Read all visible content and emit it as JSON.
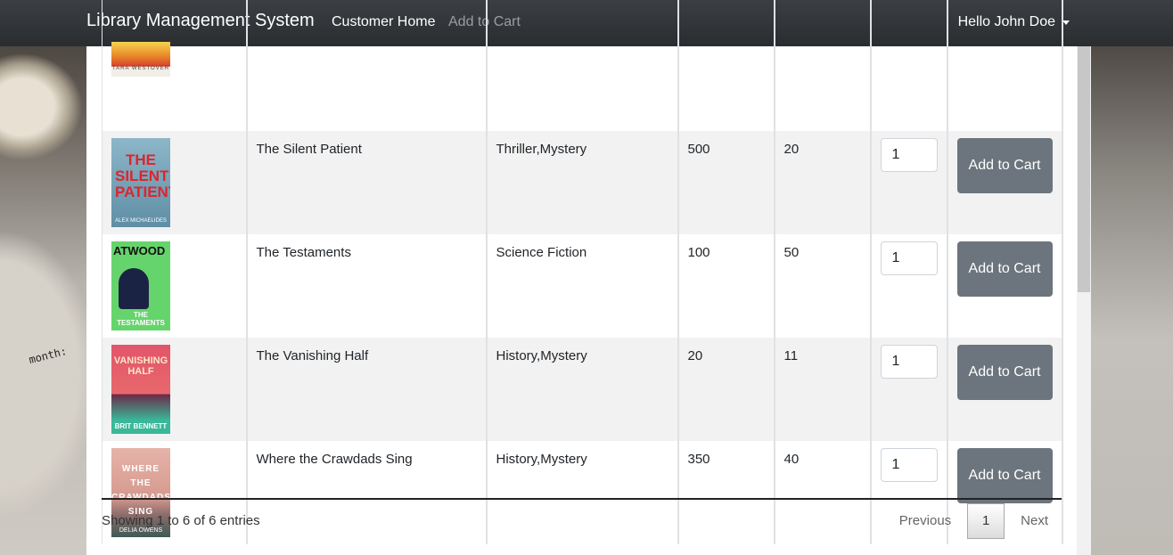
{
  "navbar": {
    "brand": "Library Management System",
    "links": [
      "Customer Home",
      "Add to Cart"
    ],
    "user_greeting": "Hello John Doe"
  },
  "table": {
    "rows": [
      {
        "title": "",
        "genre": "",
        "price": "",
        "stock": "",
        "qty": "",
        "cover_author": "TARA WESTOVER",
        "has_controls": false
      },
      {
        "title": "The Silent Patient",
        "genre": "Thriller,Mystery",
        "price": "500",
        "stock": "20",
        "qty": "1",
        "cover_title": "THE SILENT PATIENT",
        "cover_author": "ALEX MICHAELIDES",
        "has_controls": true
      },
      {
        "title": "The Testaments",
        "genre": "Science Fiction",
        "price": "100",
        "stock": "50",
        "qty": "1",
        "cover_title": "ATWOOD",
        "cover_author": "THE TESTAMENTS",
        "has_controls": true
      },
      {
        "title": "The Vanishing Half",
        "genre": "History,Mystery",
        "price": "20",
        "stock": "11",
        "qty": "1",
        "cover_title": "VANISHING HALF",
        "cover_author": "BRIT BENNETT",
        "has_controls": true
      },
      {
        "title": "Where the Crawdads Sing",
        "genre": "History,Mystery",
        "price": "350",
        "stock": "40",
        "qty": "1",
        "cover_title": "WHERE THE CRAWDADS SING",
        "cover_author": "DELIA OWENS",
        "has_controls": true
      }
    ],
    "add_button_label": "Add to Cart"
  },
  "footer": {
    "info": "Showing 1 to 6 of 6 entries",
    "previous": "Previous",
    "page": "1",
    "next": "Next"
  },
  "background_note_text": "month:",
  "colors": {
    "navbar": "#343a40",
    "button": "#6c757d",
    "stripe": "#f2f2f2"
  }
}
